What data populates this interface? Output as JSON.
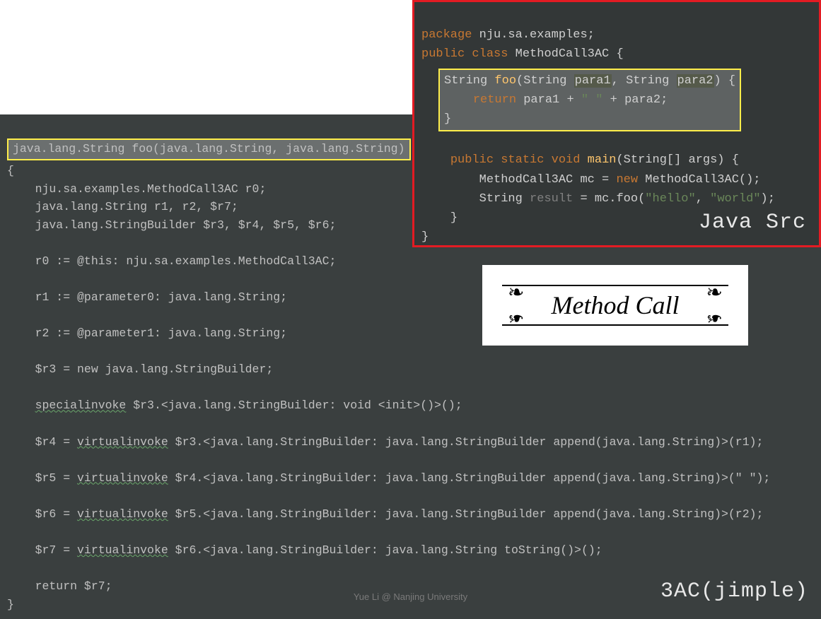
{
  "jimple": {
    "signature": "java.lang.String foo(java.lang.String, java.lang.String)",
    "open_brace": "{",
    "decl1": "    nju.sa.examples.MethodCall3AC r0;",
    "decl2": "    java.lang.String r1, r2, $r7;",
    "decl3": "    java.lang.StringBuilder $r3, $r4, $r5, $r6;",
    "r0": "    r0 := @this: nju.sa.examples.MethodCall3AC;",
    "r1": "    r1 := @parameter0: java.lang.String;",
    "r2": "    r2 := @parameter1: java.lang.String;",
    "r3": "    $r3 = new java.lang.StringBuilder;",
    "si_pre": "    ",
    "si": "specialinvoke",
    "si_post": " $r3.<java.lang.StringBuilder: void <init>()>();",
    "r4_pre": "    $r4 = ",
    "vi": "virtualinvoke",
    "r4_post": " $r3.<java.lang.StringBuilder: java.lang.StringBuilder append(java.lang.String)>(r1);",
    "r5_pre": "    $r5 = ",
    "r5_post": " $r4.<java.lang.StringBuilder: java.lang.StringBuilder append(java.lang.String)>(\" \");",
    "r6_pre": "    $r6 = ",
    "r6_post": " $r5.<java.lang.StringBuilder: java.lang.StringBuilder append(java.lang.String)>(r2);",
    "r7_pre": "    $r7 = ",
    "r7_post": " $r6.<java.lang.StringBuilder: java.lang.String toString()>();",
    "ret": "    return $r7;",
    "close_brace": "}"
  },
  "java": {
    "pkg_kw": "package",
    "pkg_name": " nju.sa.examples;",
    "pub": "public",
    "cls": "class",
    "cls_name": " MethodCall3AC {",
    "foo_type": "String ",
    "foo_name": "foo",
    "foo_paren_open": "(String ",
    "foo_p1": "para1",
    "foo_comma": ", String ",
    "foo_p2": "para2",
    "foo_paren_close": ") {",
    "foo_return_kw": "return",
    "foo_return_expr": " para1 + ",
    "foo_space_lit": "\" \"",
    "foo_return_rest": " + para2;",
    "foo_close": "}",
    "main_pub": "public",
    "main_static": "static",
    "main_void": "void",
    "main_name": "main",
    "main_params": "(String[] args) {",
    "mc_line1a": "MethodCall3AC mc = ",
    "mc_new": "new",
    "mc_line1b": " MethodCall3AC();",
    "mc_line2a": "String ",
    "mc_result": "result",
    "mc_line2b": " = mc.foo(",
    "mc_hello": "\"hello\"",
    "mc_sep": ", ",
    "mc_world": "\"world\"",
    "mc_line2c": ");",
    "main_close": "}",
    "cls_close": "}"
  },
  "labels": {
    "java_src": "Java Src",
    "jimple": "3AC(jimple)",
    "method_call": "Method Call",
    "footer": "Yue Li @ Nanjing University"
  }
}
